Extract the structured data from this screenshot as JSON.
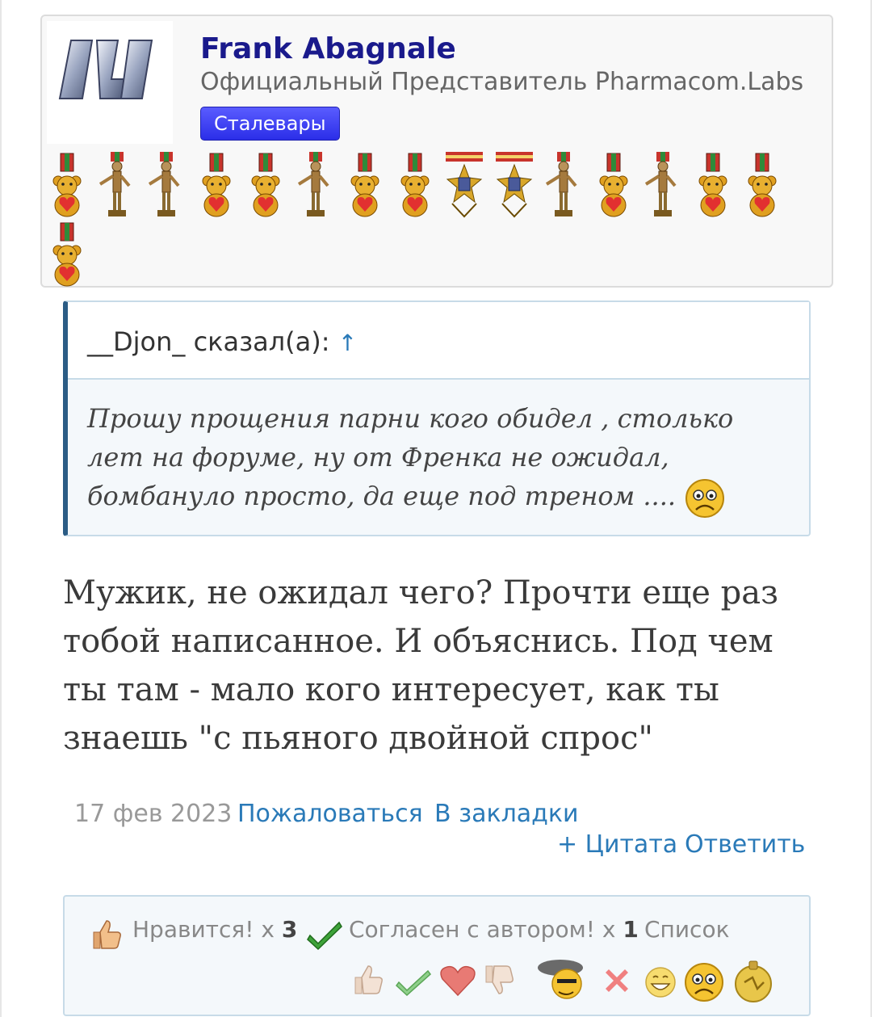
{
  "user": {
    "name": "Frank Abagnale",
    "title": "Официальный Представитель Pharmacom.Labs",
    "badge": "Сталевары"
  },
  "medals": [
    "bear-medal-icon",
    "statue-award-icon",
    "statue-award-icon",
    "bear-medal-icon",
    "bear-medal-icon",
    "statue-award-icon",
    "bear-medal-icon",
    "bear-medal-icon",
    "order-cross-icon",
    "order-cross-icon",
    "statue-award-icon",
    "bear-medal-icon",
    "statue-award-icon",
    "bear-medal-icon",
    "bear-medal-icon",
    "bear-medal-icon"
  ],
  "quote": {
    "author": "__Djon_ сказал(а):",
    "arrow": "↑",
    "text": "Прошу прощения парни кого обидел , столько лет на форуме, ну от Френка не ожидал, бомбануло просто, да еще под треном ...."
  },
  "post": {
    "text": "Мужик, не ожидал чего? Прочти еще раз тобой написанное. И объяснись. Под чем ты там - мало кого интересует, как ты знаешь \"с пьяного двойной спрос\""
  },
  "meta": {
    "date": "17 фев 2023",
    "report": "Пожаловаться",
    "bookmark": "В закладки",
    "quote": "+ Цитата",
    "reply": "Ответить"
  },
  "reactions": {
    "like_label": "Нравится! x",
    "like_count": "3",
    "agree_label": "Согласен с автором! x",
    "agree_count": "1",
    "list": "Список"
  },
  "colors": {
    "link": "#2a7ab8",
    "username": "#1a1a8c",
    "badge": "#3b3ef0"
  }
}
